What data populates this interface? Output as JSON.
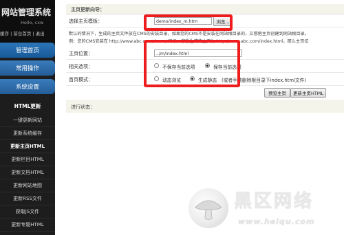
{
  "sidebar": {
    "brand": "网站管理系统",
    "greeting": "Hello, cxw",
    "links": "缓存 | 前台首页 | 退出",
    "nav": [
      {
        "label": "管理首页"
      },
      {
        "label": "常用操作"
      },
      {
        "label": "系统设置"
      }
    ],
    "section_title": "HTML更新",
    "items": [
      {
        "label": "一键更新网站"
      },
      {
        "label": "更新系统缓存"
      },
      {
        "label": "更新主页HTML"
      },
      {
        "label": "更新栏目HTML"
      },
      {
        "label": "更新文档HTML"
      },
      {
        "label": "更新网站地图"
      },
      {
        "label": "更新RSS文件"
      },
      {
        "label": "获取JS文件"
      },
      {
        "label": "更新专题HTML"
      }
    ]
  },
  "main": {
    "section_header": "主页更新向导：",
    "template": {
      "label": "选择主页模板：",
      "value": "demo/index_m.htm",
      "browse": "浏览..."
    },
    "notes": [
      "默认的情况下，生成的主页文件放在CMS的安装目录，如果您的CMS不是安装在网站根目录的，又想把主页创建到网站根目录，",
      "例：您的CMS安装在 http://www.abc.com/demo/ 目录，您想生成的主页为 http://www.abc.com/index.html，那么主页位"
    ],
    "position": {
      "label": "主页位置：",
      "value": "../m/index.html"
    },
    "options": {
      "label": "相关选项：",
      "choices": [
        "不保存当前选项",
        "保存当前选项"
      ]
    },
    "mode": {
      "label": "首页模式：",
      "choices": [
        "动态浏览",
        "生成静态"
      ],
      "hint": "(或者手动删除根目录下index.html文件)"
    },
    "buttons": {
      "preview": "预览主页",
      "update": "更新主页HTML"
    },
    "progress_label": "进行状态："
  },
  "watermark": {
    "brand": "黑区网络",
    "url": "www.heiqu.com"
  }
}
